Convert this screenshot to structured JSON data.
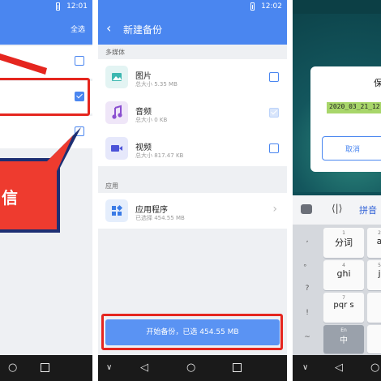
{
  "screens": {
    "left": {
      "status_time": "12:01",
      "select_all": "全选",
      "callout_text": "信",
      "colors": {
        "accent": "#4a86f0",
        "highlight": "#e5261f",
        "callout": "#ee3b2f"
      }
    },
    "middle": {
      "status_time": "12:02",
      "title": "新建备份",
      "sections": [
        {
          "label": "多媒体"
        },
        {
          "label": "应用"
        }
      ],
      "media": [
        {
          "title": "图片",
          "subtitle": "总大小 5.35 MB",
          "icon": "image-icon",
          "checked": false
        },
        {
          "title": "音频",
          "subtitle": "总大小 0 KB",
          "icon": "music-note-icon",
          "checked": true
        },
        {
          "title": "视频",
          "subtitle": "总大小 817.47 KB",
          "icon": "video-camera-icon",
          "checked": false
        }
      ],
      "apps": {
        "title": "应用程序",
        "subtitle": "已选择 454.55 MB",
        "icon": "apps-grid-icon"
      },
      "start_button": "开始备份，已选 454.55 MB"
    },
    "right": {
      "dialog_title": "保",
      "input_value": "2020_03_21_12",
      "cancel": "取消",
      "ime_label": "拼音",
      "side_keys": [
        ",",
        "。",
        "?",
        "!",
        "~"
      ],
      "keys": [
        {
          "num": "1",
          "letters": "分词"
        },
        {
          "num": "2",
          "letters": "a"
        },
        {
          "num": "4",
          "letters": "ghi"
        },
        {
          "num": "5",
          "letters": "j"
        },
        {
          "num": "7",
          "letters": "pqr s"
        }
      ],
      "lang_key": {
        "top": "En",
        "main": "中"
      }
    }
  }
}
